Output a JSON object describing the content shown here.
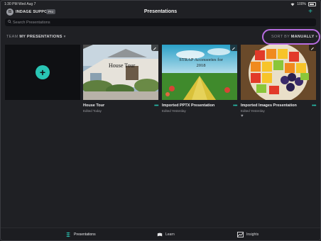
{
  "status_bar": {
    "time_date": "1:30 PM   Wed Aug 7",
    "battery": "100%"
  },
  "header": {
    "avatar_initials": "IS",
    "account_name": "INDAGE SUPPORT",
    "badge": "Pro",
    "title": "Presentations",
    "add_symbol": "+"
  },
  "search": {
    "placeholder": "Search Presentations",
    "value": ""
  },
  "filter": {
    "team_prefix": "TEAM",
    "team_value": "MY PRESENTATIONS",
    "sort_prefix": "SORT BY",
    "sort_value": "MANUALLY"
  },
  "new_card": {
    "add_symbol": "+"
  },
  "cards": [
    {
      "name": "House Tour",
      "edited": "Edited Today",
      "thumb_title": "House Tour",
      "more": "•••"
    },
    {
      "name": "Imported PPTX Presentation",
      "edited": "Edited Yesterday",
      "thumb_title": "STRAP Accessories for 2018",
      "more": "•••"
    },
    {
      "name": "Imported Images Presentation",
      "edited": "Edited Yesterday",
      "favorite": "♥",
      "more": "•••"
    }
  ],
  "tabs": [
    {
      "label": "Presentations",
      "icon": "presentations-icon",
      "active": true
    },
    {
      "label": "Learn",
      "icon": "learn-icon",
      "active": false
    },
    {
      "label": "Insights",
      "icon": "insights-icon",
      "active": false
    }
  ],
  "colors": {
    "accent": "#29c5b4",
    "highlight_circle": "#b76ce0",
    "background": "#1f2024"
  }
}
